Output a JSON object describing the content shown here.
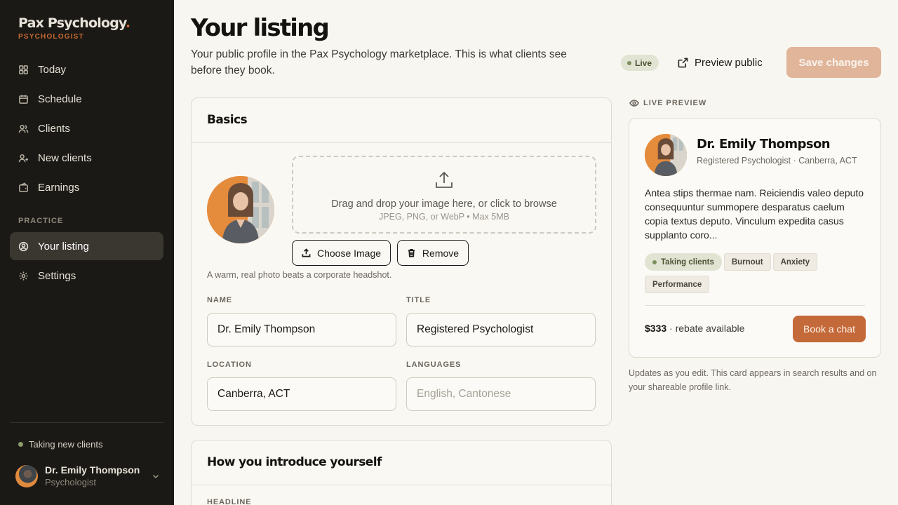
{
  "brand": {
    "name": "Pax Psychology",
    "dot": ".",
    "role": "PSYCHOLOGIST"
  },
  "nav": {
    "main": [
      {
        "label": "Today",
        "icon": "grid-icon"
      },
      {
        "label": "Schedule",
        "icon": "calendar-icon"
      },
      {
        "label": "Clients",
        "icon": "users-icon"
      },
      {
        "label": "New clients",
        "icon": "user-plus-icon"
      },
      {
        "label": "Earnings",
        "icon": "wallet-icon"
      }
    ],
    "section_label": "PRACTICE",
    "practice": [
      {
        "label": "Your listing",
        "icon": "user-circle-icon",
        "active": true
      },
      {
        "label": "Settings",
        "icon": "gear-icon"
      }
    ]
  },
  "status": {
    "taking": "Taking new clients"
  },
  "user": {
    "name": "Dr. Emily Thompson",
    "role": "Psychologist"
  },
  "header": {
    "title": "Your listing",
    "subtitle": "Your public profile in the Pax Psychology marketplace. This is what clients see before they book.",
    "live_badge": "Live",
    "preview_label": "Preview public",
    "save_label": "Save changes"
  },
  "basics": {
    "title": "Basics",
    "dropzone_main": "Drag and drop your image here, or click to browse",
    "dropzone_sub": "JPEG, PNG, or WebP • Max 5MB",
    "choose_label": "Choose Image",
    "remove_label": "Remove",
    "hint": "A warm, real photo beats a corporate headshot.",
    "name_label": "NAME",
    "name_value": "Dr. Emily Thompson",
    "title_label": "TITLE",
    "title_value": "Registered Psychologist",
    "location_label": "LOCATION",
    "location_value": "Canberra, ACT",
    "languages_label": "LANGUAGES",
    "languages_placeholder": "English, Cantonese"
  },
  "intro": {
    "title": "How you introduce yourself",
    "headline_label": "HEADLINE"
  },
  "preview": {
    "label": "LIVE PREVIEW",
    "name": "Dr. Emily Thompson",
    "subtitle": "Registered Psychologist · Canberra, ACT",
    "bio": "Antea stips thermae nam. Reiciendis valeo deputo consequuntur summopere desparatus caelum copia textus deputo. Vinculum expedita casus supplanto coro...",
    "chips": [
      "Taking clients",
      "Burnout",
      "Anxiety",
      "Performance"
    ],
    "price": "$333",
    "price_note": " · rebate available",
    "book_label": "Book a chat",
    "updates": "Updates as you edit. This card appears in search results and on your shareable profile link."
  },
  "colors": {
    "accent": "#c4693a",
    "sidebar": "#1b1915",
    "background": "#f8f6f1",
    "live": "#e2e4d3"
  }
}
